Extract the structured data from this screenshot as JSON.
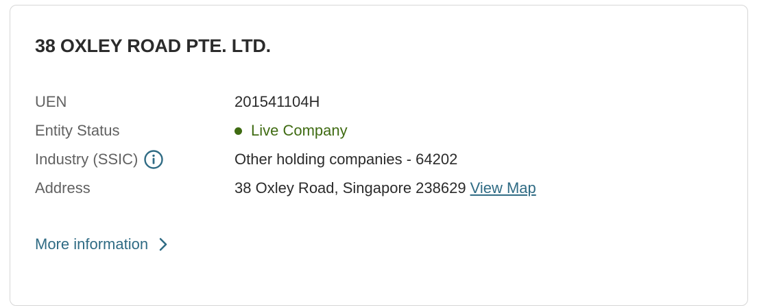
{
  "company": {
    "name": "38 OXLEY ROAD PTE. LTD."
  },
  "details": {
    "uen_label": "UEN",
    "uen_value": "201541104H",
    "status_label": "Entity Status",
    "status_value": "Live Company",
    "industry_label": "Industry (SSIC)",
    "industry_value": "Other holding companies - 64202",
    "address_label": "Address",
    "address_value": "38 Oxley Road, Singapore 238629",
    "view_map_label": "View Map"
  },
  "footer": {
    "more_info_label": "More information"
  },
  "icons": {
    "info": "info-circle-icon",
    "status": "status-dot-icon",
    "chevron": "chevron-right-icon"
  },
  "colors": {
    "status_live": "#3f6b12",
    "link": "#2f6b84",
    "label": "#616161",
    "text": "#2b2b2b"
  }
}
